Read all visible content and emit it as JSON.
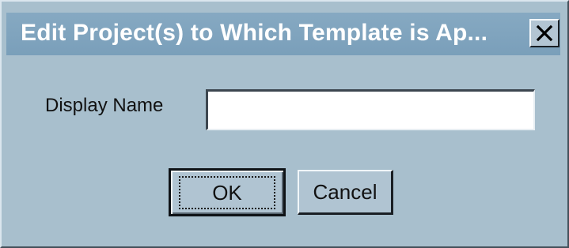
{
  "dialog": {
    "title": "Edit Project(s) to Which Template is Ap...",
    "close_label": "Close"
  },
  "form": {
    "display_name_label": "Display Name",
    "display_name_value": ""
  },
  "buttons": {
    "ok_label": "OK",
    "cancel_label": "Cancel"
  }
}
